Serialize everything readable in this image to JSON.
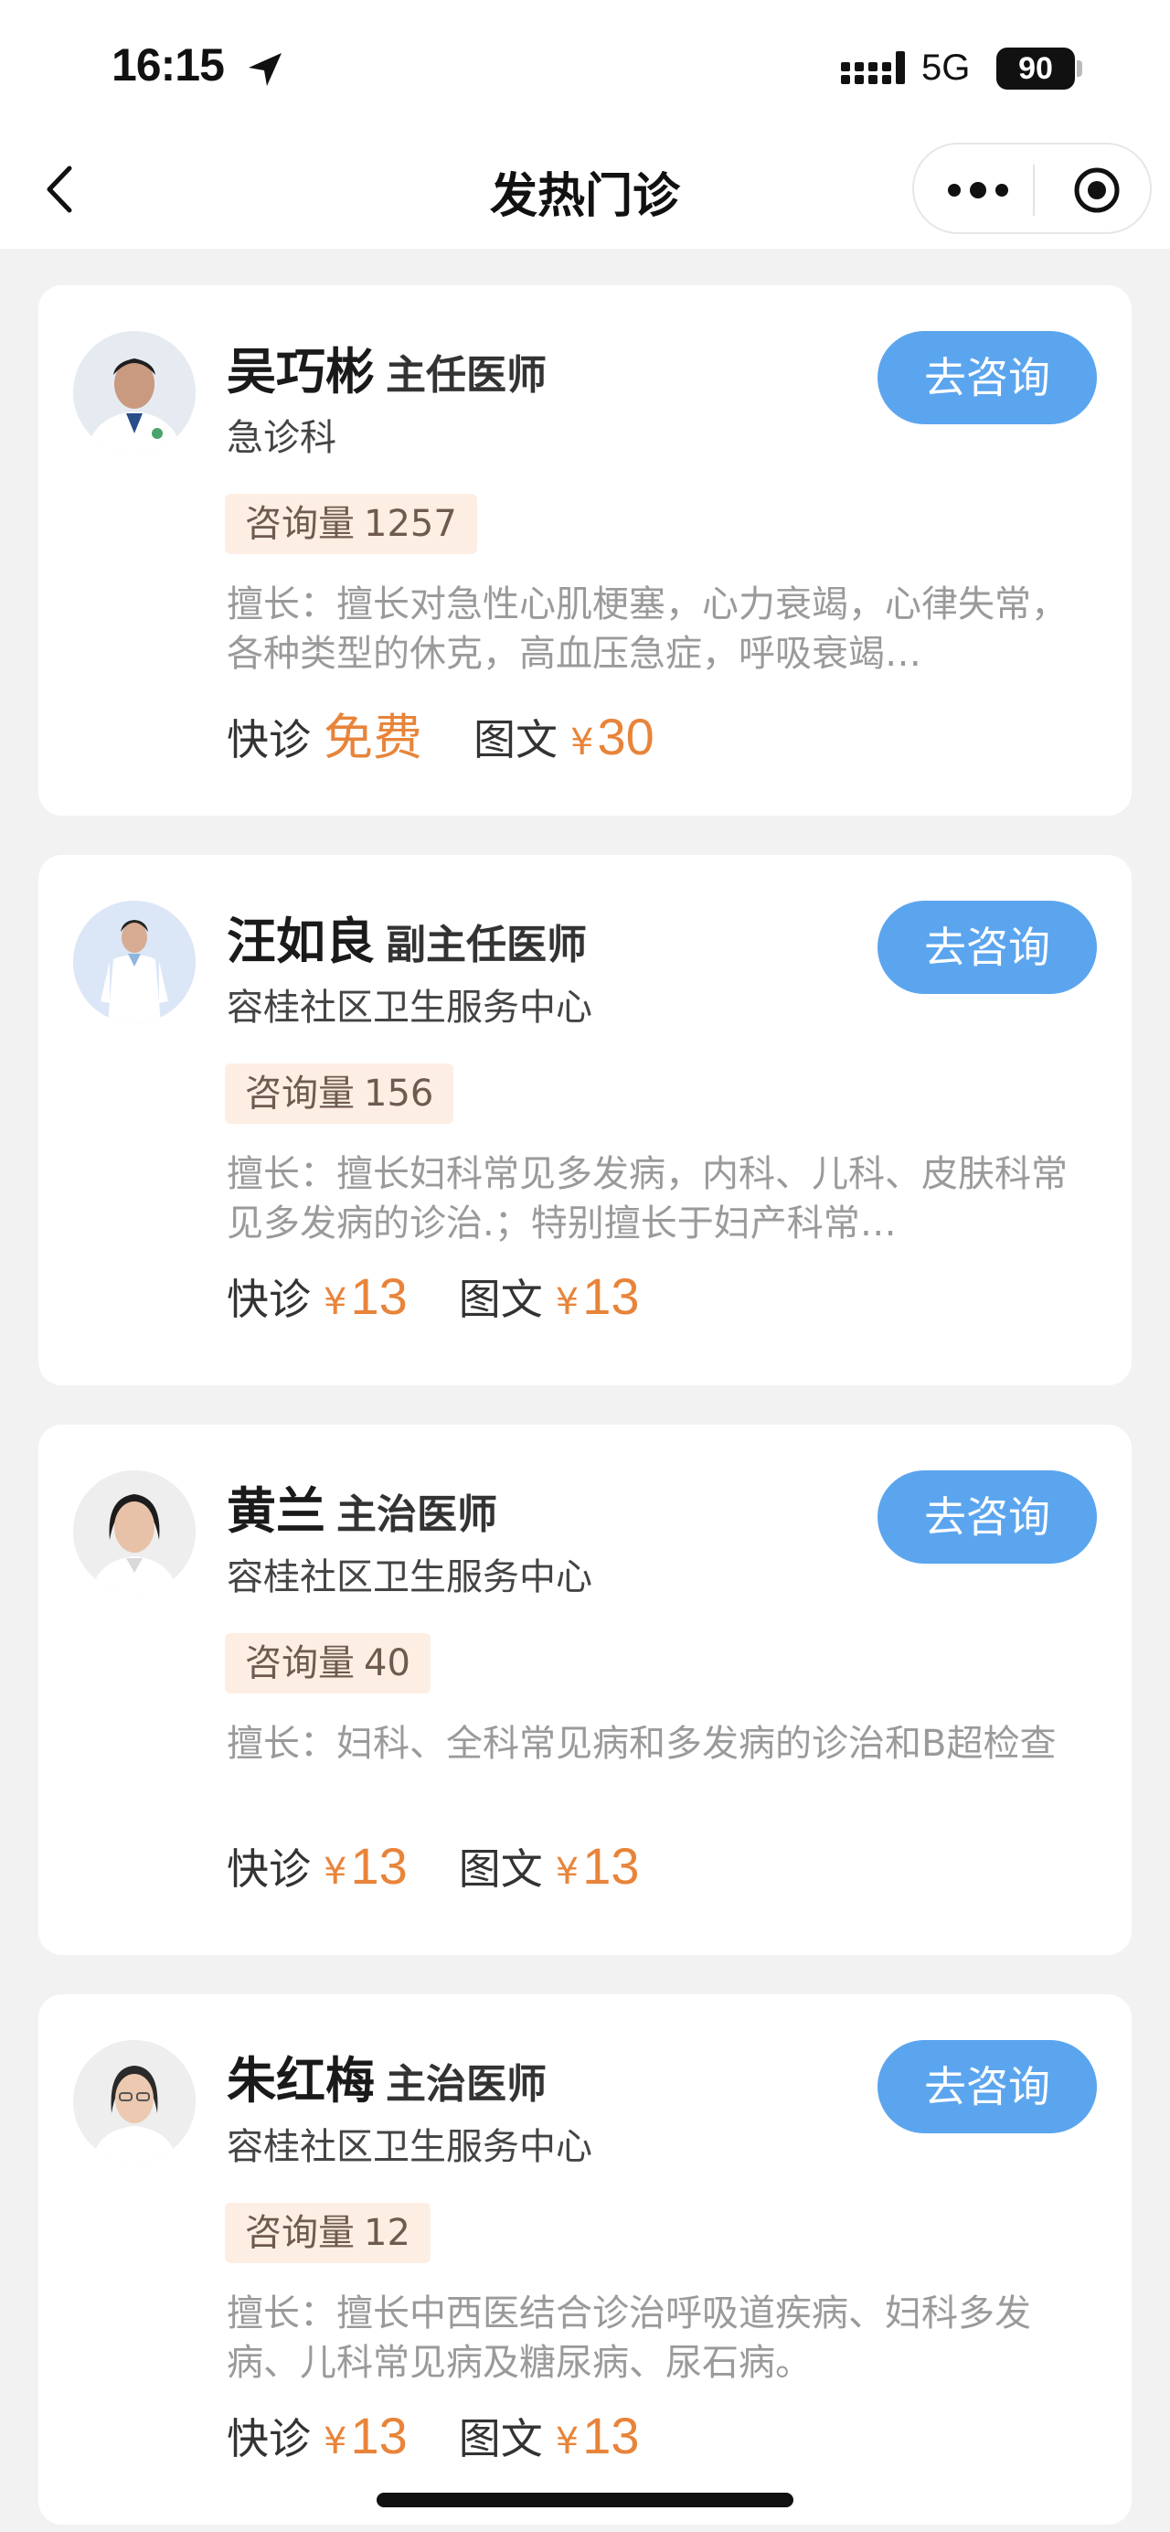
{
  "status_bar": {
    "time": "16:15",
    "network": "5G",
    "battery": "90"
  },
  "nav": {
    "title": "发热门诊"
  },
  "doctors": [
    {
      "name": "吴巧彬",
      "title": "主任医师",
      "dept": "急诊科",
      "count_label": "咨询量",
      "count": "1257",
      "expertise": "擅长：擅长对急性心肌梗塞，心力衰竭，心律失常，各种类型的休克，高血压急症，呼吸衰竭…",
      "quick_label": "快诊",
      "quick_price": "免费",
      "text_label": "图文",
      "currency": "¥",
      "text_price": "30",
      "button": "去咨询"
    },
    {
      "name": "汪如良",
      "title": "副主任医师",
      "dept": "容桂社区卫生服务中心",
      "count_label": "咨询量",
      "count": "156",
      "expertise": "擅长：擅长妇科常见多发病，内科、儿科、皮肤科常见多发病的诊治.；特别擅长于妇产科常…",
      "quick_label": "快诊",
      "currency": "¥",
      "quick_price": "13",
      "text_label": "图文",
      "text_price": "13",
      "button": "去咨询"
    },
    {
      "name": "黄兰",
      "title": "主治医师",
      "dept": "容桂社区卫生服务中心",
      "count_label": "咨询量",
      "count": "40",
      "expertise": "擅长：妇科、全科常见病和多发病的诊治和B超检查",
      "quick_label": "快诊",
      "currency": "¥",
      "quick_price": "13",
      "text_label": "图文",
      "text_price": "13",
      "button": "去咨询"
    },
    {
      "name": "朱红梅",
      "title": "主治医师",
      "dept": "容桂社区卫生服务中心",
      "count_label": "咨询量",
      "count": "12",
      "expertise": "擅长：擅长中西医结合诊治呼吸道疾病、妇科多发病、儿科常见病及糖尿病、尿石病。",
      "quick_label": "快诊",
      "currency": "¥",
      "quick_price": "13",
      "text_label": "图文",
      "text_price": "13",
      "button": "去咨询"
    }
  ],
  "theme": {
    "accent": "#5ba5ef",
    "price": "#e8843a",
    "badge_bg": "#fdeee4",
    "page_bg": "#f2f2f2"
  }
}
